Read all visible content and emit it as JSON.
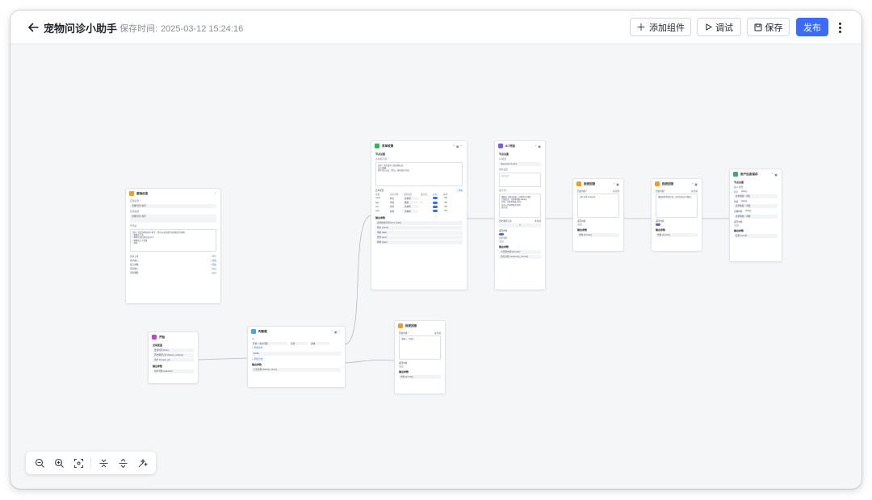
{
  "header": {
    "title": "宠物问诊小助手",
    "save_time_label": "保存时间:",
    "save_time": "2025-03-12 15:24:16",
    "add_component": "添加组件",
    "debug": "调试",
    "save": "保存",
    "publish": "发布"
  },
  "colors": {
    "primary": "#3b6cf6",
    "start": "#c243c9",
    "basic": "#f59a23",
    "llm": "#33b55f",
    "judge": "#4aa3ef",
    "ai": "#7a5cf5"
  },
  "nodes": {
    "basic": {
      "title": "基础信息",
      "app_name_label": "应用名称 *",
      "app_name": "宠物问诊小助手",
      "desc_label": "应用描述",
      "desc": "宠物问诊小助手",
      "opening_label": "开场白",
      "opening": "您好，我是宠物问诊小助手，我可以向您提供宠物相关的问题。\n• 猫粮怎么选\n• 狗狗生病后要注意什么?\n• 猫咪的主人需要\n• 其他",
      "upload_label": "文件上传",
      "user_input_label": "用户输入",
      "add_link": "+ 添加",
      "interface_label": "接口参数",
      "voice_input_label": "语音输入",
      "voice_output_label": "语音播报"
    },
    "start": {
      "title": "开始",
      "section": "全局变量",
      "fields": [
        "会话时间 {time}",
        "历史聊天记录 {history_context}",
        "用户 ID {user_id}"
      ],
      "output_label": "输出参数",
      "output": "用户问题 {question}"
    },
    "judge": {
      "title": "判断器",
      "if_label": "IF",
      "condition_var": "开始 > 用户问题",
      "condition_op": "包含",
      "condition_value": "宠物",
      "add_condition": "+ 添加条件",
      "else_label": "ELSE",
      "add_branch": "+ 添加分支",
      "output_label": "输出参数",
      "output": "分支名称 {branch_name}"
    },
    "form": {
      "title": "表单收集",
      "section": "节点设置",
      "prompt_label": "表单提示语 *",
      "prompt": "您好，请先填写下面宠物信息：\n汪汪/喵喵\n填写完后点击「提交」按钮进行问诊。",
      "fields_label": "表单配置",
      "add_link": "+ 添加",
      "table_headers": [
        "参数",
        "显示名称",
        "组件类型",
        "最大值",
        "必填",
        "操作"
      ],
      "rows": [
        {
          "param": "name",
          "label": "姓名",
          "type": "文本框",
          "max": ""
        },
        {
          "param": "age",
          "label": "年龄",
          "type": "数值",
          "max": "1"
        },
        {
          "param": "sex",
          "label": "性别",
          "type": "文本框",
          "max": ""
        },
        {
          "param": "type",
          "label": "种类",
          "type": "文本框",
          "max": ""
        }
      ],
      "output_label": "输出参数",
      "outputs": [
        "表单提交时间 {form_data}",
        "姓名 {name}",
        "年龄 {age}",
        "性别 {sex}",
        "种类 {type}"
      ]
    },
    "ai": {
      "title": "AI 对话",
      "section": "节点设置",
      "model_label": "AI 模型",
      "model": "deepseek-r1-plus",
      "role_label": "角色设定",
      "role_placeholder": "角色设定",
      "prompt_label": "提示词 *",
      "prompt": "根据以下相关知识，回答用户问题:\n已知信息：{{表单收集.name}}\n年龄：{{表单收集.age}}\n并进入到宠物医生角色\n提示语：",
      "history_label": "历史聊天记录",
      "history_value": "0",
      "history_unit": "条对话",
      "stream_label": "返回内容",
      "think_label": "显示思考",
      "output_label": "输出参数",
      "outputs": [
        "AI 回答内容 {answer}",
        "思考过程 {reasoning_content}"
      ]
    },
    "reply1": {
      "title": "指定回复",
      "content_label": "回复内容 *",
      "tag": "@引用",
      "content": "{{AI 对话.answer}}",
      "return_label": "返回内容",
      "output_label": "输出参数",
      "output": "内容 {answer}"
    },
    "reply2": {
      "title": "指定回复",
      "content_label": "回复内容 *",
      "tag": "@引用",
      "content": "根据您提供的信息，医生给出如下建议。",
      "return_label": "返回内容",
      "output_label": "输出参数",
      "output": "内容 {answer}"
    },
    "reply3": {
      "title": "指定回复",
      "content_label": "回复内容 *",
      "tag": "@引用",
      "content": "请输入「宠物」",
      "return_label": "返回内容",
      "output_label": "输出参数",
      "output": "内容 {answer}"
    },
    "save": {
      "title": "用户信息保存",
      "section": "节点设置",
      "input_label": "输入参数",
      "fields": [
        {
          "name": "名字",
          "tag": "string",
          "value": "表单收集 > 姓名"
        },
        {
          "name": "年龄",
          "tag": "string",
          "value": "表单收集 > 年龄"
        },
        {
          "name": "宠物种类",
          "tag": "string",
          "value": "表单收集 > 种类"
        }
      ],
      "return_label": "返回内容",
      "output_label": "输出参数",
      "output": "结果 {result}"
    }
  },
  "toolbar": {
    "zoom_out": "zoom-out-icon",
    "zoom_in": "zoom-in-icon",
    "fit": "fit-view-icon",
    "collapse": "collapse-icon",
    "expand": "expand-icon",
    "beautify": "beautify-icon"
  }
}
